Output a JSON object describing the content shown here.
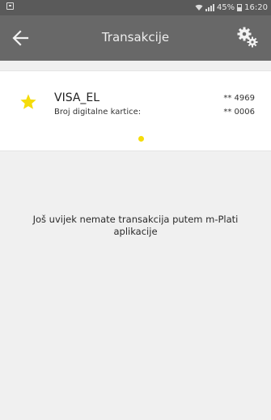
{
  "status_bar": {
    "battery": "45%",
    "time": "16:20",
    "left_icon": "notification-icon",
    "right_icons": [
      "wifi-icon",
      "signal-icon",
      "battery-icon"
    ]
  },
  "header": {
    "title": "Transakcije",
    "back_icon": "back-arrow-icon",
    "settings_icon": "settings-gears-icon"
  },
  "card": {
    "name": "VISA_EL",
    "number_masked": "** 4969",
    "digital_label": "Broj digitalne kartice:",
    "digital_number_masked": "** 0006",
    "favorite_icon": "star-icon",
    "star_color": "#f5dc0a",
    "pager_dot_color": "#f5dc0a"
  },
  "main": {
    "empty_message": "Još uvijek nemate transakcija putem m-Plati aplikacije"
  },
  "colors": {
    "status_bar": "#5a5a5a",
    "app_bar": "#686868",
    "background": "#f0f0f0"
  }
}
